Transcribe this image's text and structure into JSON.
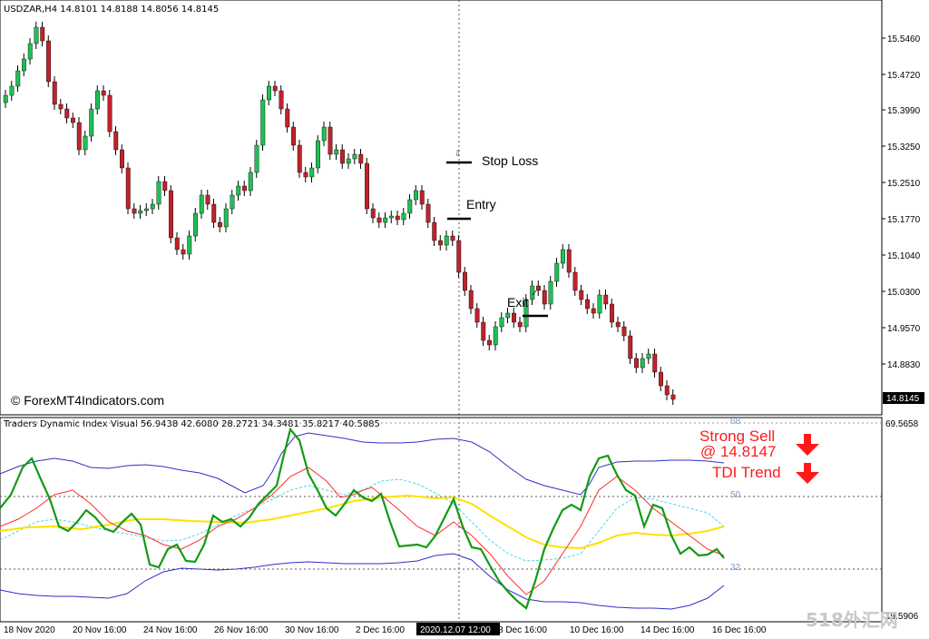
{
  "main_chart": {
    "header": "USDZAR,H4  14.8101 14.8188 14.8056 14.8145",
    "price_labels": [
      "15.5460",
      "15.4720",
      "15.3990",
      "15.3250",
      "15.2510",
      "15.1770",
      "15.1040",
      "15.0300",
      "14.9570",
      "14.8830"
    ],
    "current_price": "14.8145",
    "copyright": "© ForexMT4Indicators.com",
    "annotations": {
      "stop_loss": "Stop Loss",
      "entry": "Entry",
      "exit": "Exit"
    }
  },
  "indicator": {
    "header": "Traders Dynamic Index Visual 56.9438 42.6080 28.2721 34.3481 35.8217 40.5885",
    "levels": [
      "68",
      "50",
      "32"
    ],
    "right_top": "69.5658",
    "right_bottom": "19.5906"
  },
  "signal": {
    "line1": "Strong Sell",
    "line2": "@ 14.8147",
    "line3": "TDI Trend",
    "color": "#ff1a1a"
  },
  "time_axis": {
    "labels": [
      "18 Nov 2020",
      "20 Nov 16:00",
      "24 Nov 16:00",
      "26 Nov 16:00",
      "30 Nov 16:00",
      "2 Dec 16:00",
      "8 Dec 16:00",
      "10 Dec 16:00",
      "14 Dec 16:00",
      "16 Dec 16:00"
    ],
    "cursor_label": "2020.12.07 12:00"
  },
  "watermark": "518外汇网",
  "colors": {
    "bull": "#1fbf55",
    "bear": "#c0222a",
    "wick": "#000000"
  }
}
